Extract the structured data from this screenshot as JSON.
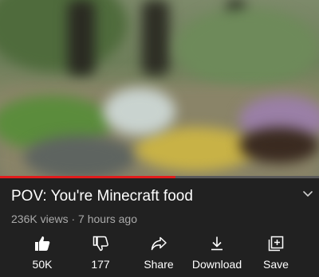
{
  "video": {
    "progress_fraction": 0.55
  },
  "info": {
    "title": "POV: You're Minecraft food",
    "views": "236K views",
    "separator": "·",
    "age": "7 hours ago"
  },
  "actions": [
    {
      "label": "50K",
      "icon": "thumbs-up-icon"
    },
    {
      "label": "177",
      "icon": "thumbs-down-icon"
    },
    {
      "label": "Share",
      "icon": "share-icon"
    },
    {
      "label": "Download",
      "icon": "download-icon"
    },
    {
      "label": "Save",
      "icon": "save-to-playlist-icon"
    }
  ],
  "colors": {
    "background": "#212121",
    "progress": "#e11c1c",
    "text": "#ffffff",
    "meta_text": "#aaaaaa"
  }
}
